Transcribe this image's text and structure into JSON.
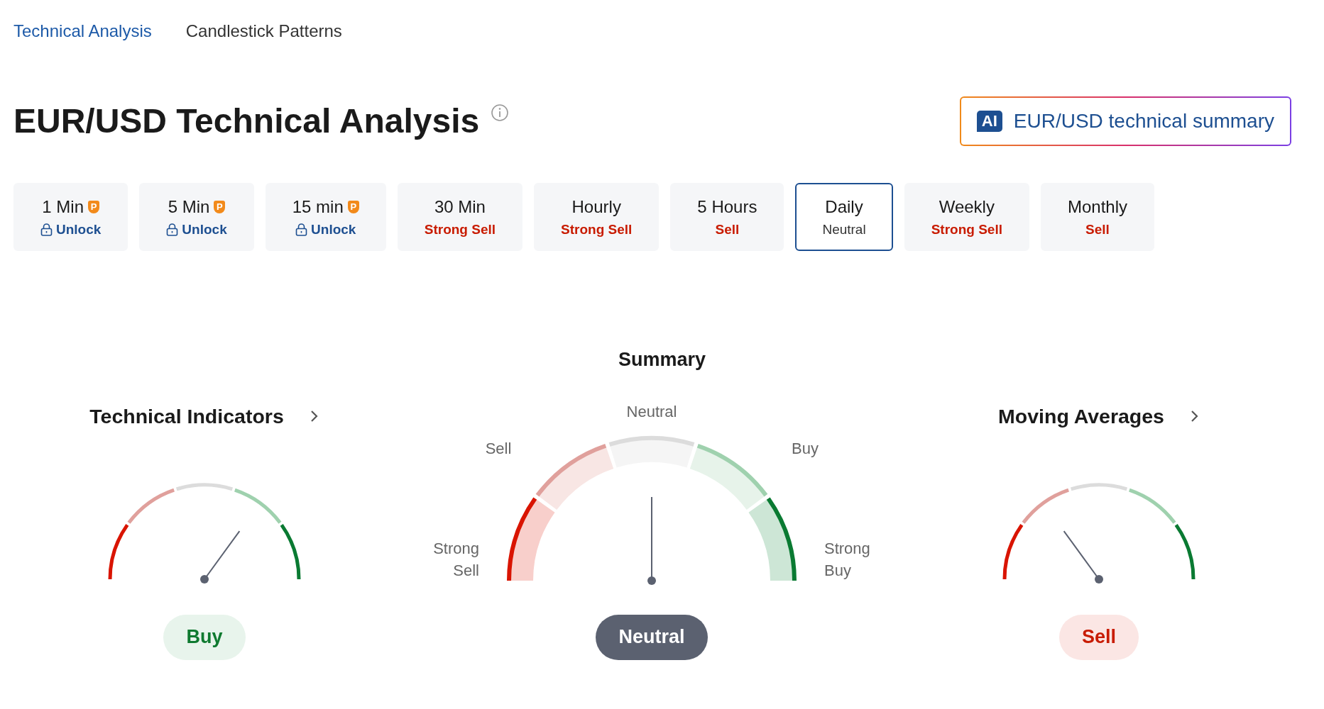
{
  "nav": [
    {
      "label": "Technical Analysis",
      "selected": true
    },
    {
      "label": "Candlestick Patterns",
      "selected": false
    }
  ],
  "title": "EUR/USD Technical Analysis",
  "ai_button": {
    "badge": "AI",
    "label": "EUR/USD technical summary"
  },
  "timeframes": [
    {
      "label": "1 Min",
      "badge": "P",
      "status": "Unlock",
      "kind": "locked",
      "selected": false
    },
    {
      "label": "5 Min",
      "badge": "P",
      "status": "Unlock",
      "kind": "locked",
      "selected": false
    },
    {
      "label": "15 min",
      "badge": "P",
      "status": "Unlock",
      "kind": "locked",
      "selected": false
    },
    {
      "label": "30 Min",
      "status": "Strong Sell",
      "kind": "sell",
      "selected": false
    },
    {
      "label": "Hourly",
      "status": "Strong Sell",
      "kind": "sell",
      "selected": false
    },
    {
      "label": "5 Hours",
      "status": "Sell",
      "kind": "sell",
      "selected": false
    },
    {
      "label": "Daily",
      "status": "Neutral",
      "kind": "neutral",
      "selected": true
    },
    {
      "label": "Weekly",
      "status": "Strong Sell",
      "kind": "sell",
      "selected": false
    },
    {
      "label": "Monthly",
      "status": "Sell",
      "kind": "sell",
      "selected": false
    }
  ],
  "summary": {
    "title": "Summary",
    "scale_labels": [
      "Strong Sell",
      "Sell",
      "Neutral",
      "Buy",
      "Strong Buy"
    ],
    "signal": {
      "label": "Neutral",
      "kind": "neutral"
    }
  },
  "technical_indicators": {
    "title": "Technical Indicators",
    "signal": {
      "label": "Buy",
      "kind": "buy"
    }
  },
  "moving_averages": {
    "title": "Moving Averages",
    "signal": {
      "label": "Sell",
      "kind": "sell"
    }
  }
}
